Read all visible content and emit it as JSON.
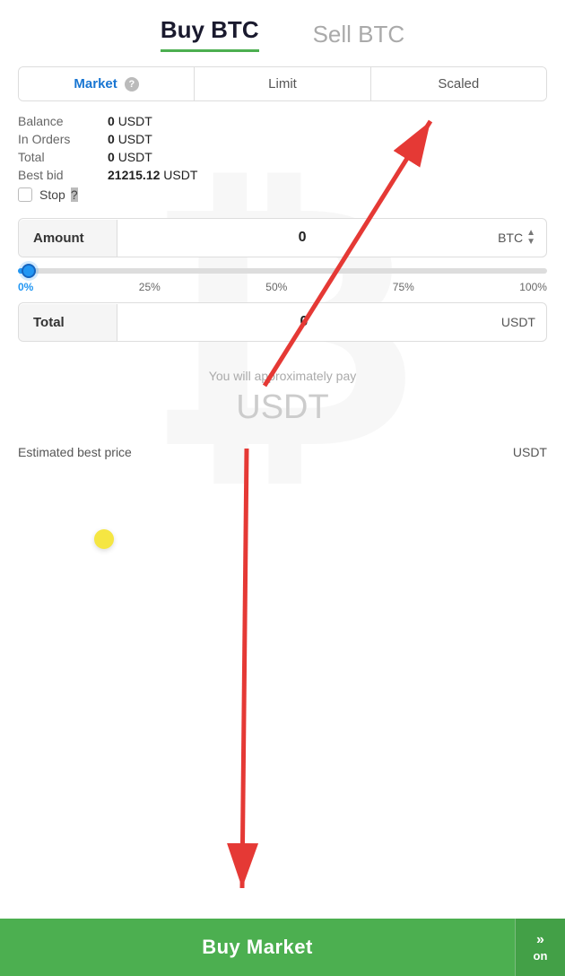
{
  "header": {
    "buy_label": "Buy BTC",
    "sell_label": "Sell BTC"
  },
  "order_tabs": {
    "market_label": "Market",
    "limit_label": "Limit",
    "scaled_label": "Scaled",
    "active": "market",
    "help_text": "?"
  },
  "info": {
    "balance_label": "Balance",
    "balance_value": "0",
    "balance_currency": "USDT",
    "in_orders_label": "In Orders",
    "in_orders_value": "0",
    "in_orders_currency": "USDT",
    "total_label": "Total",
    "total_value": "0",
    "total_currency": "USDT",
    "best_bid_label": "Best bid",
    "best_bid_value": "21215.12",
    "best_bid_currency": "USDT",
    "stop_label": "Stop"
  },
  "amount_field": {
    "label": "Amount",
    "value": "0",
    "currency": "BTC"
  },
  "slider": {
    "percent": "0%",
    "labels": [
      "0%",
      "25%",
      "50%",
      "75%",
      "100%"
    ]
  },
  "total_field": {
    "label": "Total",
    "value": "0",
    "currency": "USDT"
  },
  "pay_info": {
    "label": "You will approximately pay",
    "amount": "USDT"
  },
  "estimated": {
    "label": "Estimated best price",
    "value": "USDT"
  },
  "buy_button": {
    "label": "Buy Market",
    "on_label": "on"
  }
}
